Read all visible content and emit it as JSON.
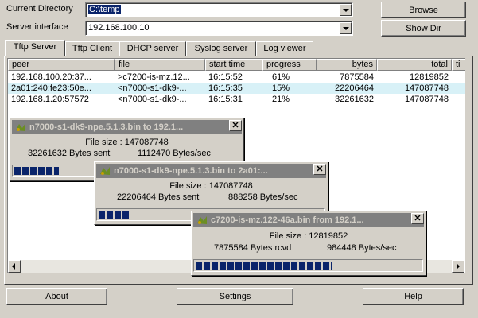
{
  "labels": {
    "current_directory": "Current Directory",
    "server_interface": "Server interface"
  },
  "current_directory": "C:\\temp",
  "server_interface": "192.168.100.10",
  "buttons": {
    "browse": "Browse",
    "show_dir": "Show Dir",
    "about": "About",
    "settings": "Settings",
    "help": "Help"
  },
  "tabs": [
    {
      "label": "Tftp Server",
      "active": true
    },
    {
      "label": "Tftp Client"
    },
    {
      "label": "DHCP server"
    },
    {
      "label": "Syslog server"
    },
    {
      "label": "Log viewer"
    }
  ],
  "columns": [
    "peer",
    "file",
    "start time",
    "progress",
    "bytes",
    "total",
    "ti"
  ],
  "rows": [
    {
      "peer": "192.168.100.20:37...",
      "file": ">c7200-is-mz.12...",
      "start": "16:15:52",
      "progress": "61%",
      "bytes": "7875584",
      "total": "12819852"
    },
    {
      "peer": "2a01:240:fe23:50e...",
      "file": "<n7000-s1-dk9-...",
      "start": "16:15:35",
      "progress": "15%",
      "bytes": "22206464",
      "total": "147087748"
    },
    {
      "peer": "192.168.1.20:57572",
      "file": "<n7000-s1-dk9-...",
      "start": "16:15:31",
      "progress": "21%",
      "bytes": "32261632",
      "total": "147087748"
    }
  ],
  "dialogs": [
    {
      "title": "n7000-s1-dk9-npe.5.1.3.bin to 192.1...",
      "filesize": "File size : 147087748",
      "bytes_text": "32261632 Bytes sent",
      "rate": "1112470 Bytes/sec",
      "progress": 0.21
    },
    {
      "title": "n7000-s1-dk9-npe.5.1.3.bin to 2a01:...",
      "filesize": "File size : 147087748",
      "bytes_text": "22206464 Bytes sent",
      "rate": "888258 Bytes/sec",
      "progress": 0.15
    },
    {
      "title": "c7200-is-mz.122-46a.bin from 192.1...",
      "filesize": "File size : 12819852",
      "bytes_text": "7875584 Bytes rcvd",
      "rate": "984448 Bytes/sec",
      "progress": 0.61
    }
  ],
  "colors": {
    "selection": "#0a246a",
    "row_highlight": "#d8f1f7",
    "face": "#d4d0c8",
    "inactive_title": "#808080"
  }
}
